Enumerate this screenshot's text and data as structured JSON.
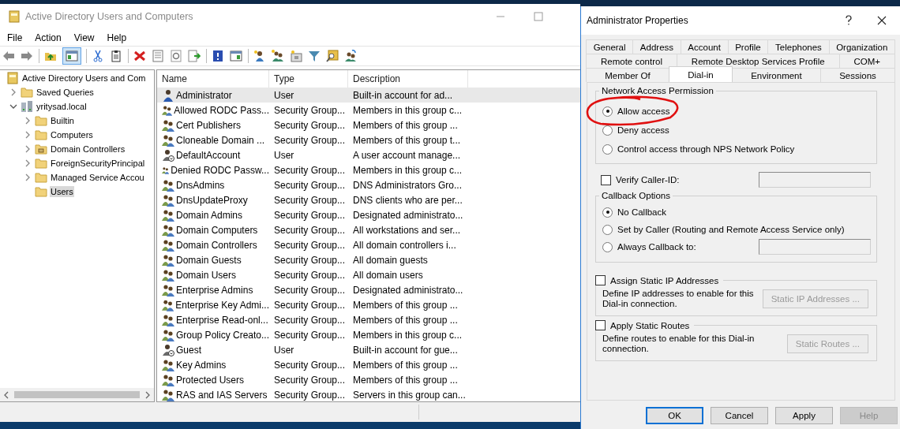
{
  "main_window": {
    "title": "Active Directory Users and Computers",
    "menu": [
      "File",
      "Action",
      "View",
      "Help"
    ],
    "tree": [
      {
        "label": "Active Directory Users and Com",
        "kind": "snap-in",
        "expandable": false,
        "selected": false,
        "children": [
          {
            "label": "Saved Queries",
            "kind": "folder",
            "expandable": true,
            "expanded": false,
            "selected": false
          },
          {
            "label": "yritysad.local",
            "kind": "domain",
            "expandable": true,
            "expanded": true,
            "selected": false,
            "children": [
              {
                "label": "Builtin",
                "kind": "folder",
                "expandable": true,
                "expanded": false,
                "selected": false
              },
              {
                "label": "Computers",
                "kind": "folder",
                "expandable": true,
                "expanded": false,
                "selected": false
              },
              {
                "label": "Domain Controllers",
                "kind": "ou",
                "expandable": true,
                "expanded": false,
                "selected": false
              },
              {
                "label": "ForeignSecurityPrincipal",
                "kind": "folder",
                "expandable": true,
                "expanded": false,
                "selected": false
              },
              {
                "label": "Managed Service Accou",
                "kind": "folder",
                "expandable": true,
                "expanded": false,
                "selected": false
              },
              {
                "label": "Users",
                "kind": "folder",
                "expandable": false,
                "selected": true
              }
            ]
          }
        ]
      }
    ],
    "table": {
      "columns": [
        "Name",
        "Type",
        "Description"
      ],
      "rows": [
        {
          "name": "Administrator",
          "type": "User",
          "description": "Built-in account for ad...",
          "kind": "user",
          "selected": true
        },
        {
          "name": "Allowed RODC Pass...",
          "type": "Security Group...",
          "description": "Members in this group c...",
          "kind": "group",
          "selected": false
        },
        {
          "name": "Cert Publishers",
          "type": "Security Group...",
          "description": "Members of this group ...",
          "kind": "group",
          "selected": false
        },
        {
          "name": "Cloneable Domain ...",
          "type": "Security Group...",
          "description": "Members of this group t...",
          "kind": "group",
          "selected": false
        },
        {
          "name": "DefaultAccount",
          "type": "User",
          "description": "A user account manage...",
          "kind": "disabled-user",
          "selected": false
        },
        {
          "name": "Denied RODC Passw...",
          "type": "Security Group...",
          "description": "Members in this group c...",
          "kind": "group",
          "selected": false
        },
        {
          "name": "DnsAdmins",
          "type": "Security Group...",
          "description": "DNS Administrators Gro...",
          "kind": "group",
          "selected": false
        },
        {
          "name": "DnsUpdateProxy",
          "type": "Security Group...",
          "description": "DNS clients who are per...",
          "kind": "group",
          "selected": false
        },
        {
          "name": "Domain Admins",
          "type": "Security Group...",
          "description": "Designated administrato...",
          "kind": "group",
          "selected": false
        },
        {
          "name": "Domain Computers",
          "type": "Security Group...",
          "description": "All workstations and ser...",
          "kind": "group",
          "selected": false
        },
        {
          "name": "Domain Controllers",
          "type": "Security Group...",
          "description": "All domain controllers i...",
          "kind": "group",
          "selected": false
        },
        {
          "name": "Domain Guests",
          "type": "Security Group...",
          "description": "All domain guests",
          "kind": "group",
          "selected": false
        },
        {
          "name": "Domain Users",
          "type": "Security Group...",
          "description": "All domain users",
          "kind": "group",
          "selected": false
        },
        {
          "name": "Enterprise Admins",
          "type": "Security Group...",
          "description": "Designated administrato...",
          "kind": "group",
          "selected": false
        },
        {
          "name": "Enterprise Key Admi...",
          "type": "Security Group...",
          "description": "Members of this group ...",
          "kind": "group",
          "selected": false
        },
        {
          "name": "Enterprise Read-onl...",
          "type": "Security Group...",
          "description": "Members of this group ...",
          "kind": "group",
          "selected": false
        },
        {
          "name": "Group Policy Creato...",
          "type": "Security Group...",
          "description": "Members in this group c...",
          "kind": "group",
          "selected": false
        },
        {
          "name": "Guest",
          "type": "User",
          "description": "Built-in account for gue...",
          "kind": "disabled-user",
          "selected": false
        },
        {
          "name": "Key Admins",
          "type": "Security Group...",
          "description": "Members of this group ...",
          "kind": "group",
          "selected": false
        },
        {
          "name": "Protected Users",
          "type": "Security Group...",
          "description": "Members of this group ...",
          "kind": "group",
          "selected": false
        },
        {
          "name": "RAS and IAS Servers",
          "type": "Security Group...",
          "description": "Servers in this group can...",
          "kind": "group",
          "selected": false
        }
      ]
    }
  },
  "dialog": {
    "title": "Administrator Properties",
    "tab_rows": [
      [
        {
          "label": "General",
          "selected": false
        },
        {
          "label": "Address",
          "selected": false
        },
        {
          "label": "Account",
          "selected": false
        },
        {
          "label": "Profile",
          "selected": false
        },
        {
          "label": "Telephones",
          "selected": false
        },
        {
          "label": "Organization",
          "selected": false
        }
      ],
      [
        {
          "label": "Remote control",
          "selected": false
        },
        {
          "label": "Remote Desktop Services Profile",
          "selected": false
        },
        {
          "label": "COM+",
          "selected": false
        }
      ],
      [
        {
          "label": "Member Of",
          "selected": false
        },
        {
          "label": "Dial-in",
          "selected": true
        },
        {
          "label": "Environment",
          "selected": false
        },
        {
          "label": "Sessions",
          "selected": false
        }
      ]
    ],
    "network_access": {
      "legend": "Network Access Permission",
      "options": [
        {
          "label": "Allow access",
          "selected": true,
          "circled": true
        },
        {
          "label": "Deny access",
          "selected": false,
          "circled": false
        },
        {
          "label": "Control access through NPS Network Policy",
          "selected": false,
          "circled": false
        }
      ]
    },
    "verify_caller_id": {
      "label": "Verify Caller-ID:",
      "checked": false
    },
    "callback": {
      "legend": "Callback Options",
      "options": [
        {
          "label": "No Callback",
          "selected": true,
          "has_field": false
        },
        {
          "label": "Set by Caller (Routing and Remote Access Service only)",
          "selected": false,
          "has_field": false
        },
        {
          "label": "Always Callback to:",
          "selected": false,
          "has_field": true
        }
      ]
    },
    "static_ip": {
      "label": "Assign Static IP Addresses",
      "checked": false,
      "description": "Define IP addresses to enable for this Dial-in connection.",
      "button": {
        "label": "Static IP Addresses ...",
        "disabled": true
      }
    },
    "static_routes": {
      "label": "Apply Static Routes",
      "checked": false,
      "description": "Define routes to enable for this Dial-in connection.",
      "button": {
        "label": "Static Routes ...",
        "disabled": true
      }
    },
    "buttons": [
      {
        "label": "OK",
        "default": true,
        "disabled": false
      },
      {
        "label": "Cancel",
        "default": false,
        "disabled": false
      },
      {
        "label": "Apply",
        "default": false,
        "disabled": false
      },
      {
        "label": "Help",
        "default": false,
        "disabled": true
      }
    ]
  }
}
